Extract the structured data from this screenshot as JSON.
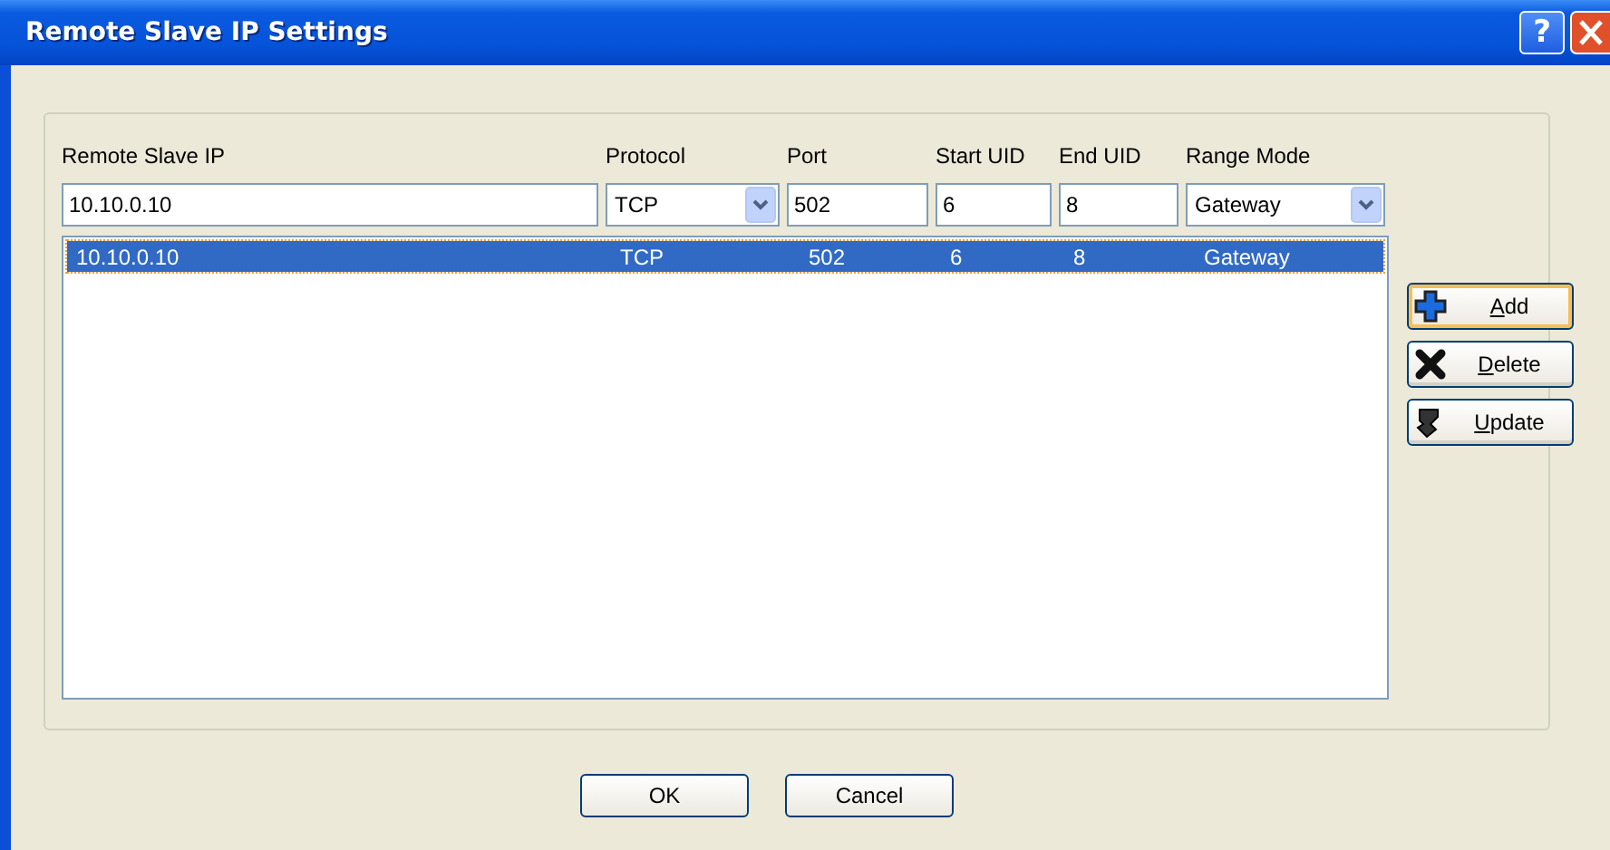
{
  "window": {
    "title": "Remote Slave IP Settings",
    "help_button": "?"
  },
  "fields": [
    {
      "label": "Remote Slave IP",
      "kind": "text",
      "value": "10.10.0.10"
    },
    {
      "label": "Protocol",
      "kind": "combo",
      "value": "TCP"
    },
    {
      "label": "Port",
      "kind": "text",
      "value": "502"
    },
    {
      "label": "Start UID",
      "kind": "text",
      "value": "6"
    },
    {
      "label": "End UID",
      "kind": "text",
      "value": "8"
    },
    {
      "label": "Range Mode",
      "kind": "combo",
      "value": "Gateway"
    }
  ],
  "rows": [
    {
      "selected": true,
      "cells": [
        "10.10.0.10",
        "TCP",
        "502",
        "6",
        "8",
        "Gateway"
      ]
    }
  ],
  "side_buttons": [
    {
      "label": "Add",
      "kind": "plus",
      "focused": true,
      "mnemonic_first": true
    },
    {
      "label": "Delete",
      "kind": "cross",
      "focused": false,
      "mnemonic_first": true
    },
    {
      "label": "Update",
      "kind": "arrow",
      "focused": false,
      "mnemonic_first": true
    }
  ],
  "buttons": [
    {
      "label": "OK"
    },
    {
      "label": "Cancel"
    }
  ]
}
